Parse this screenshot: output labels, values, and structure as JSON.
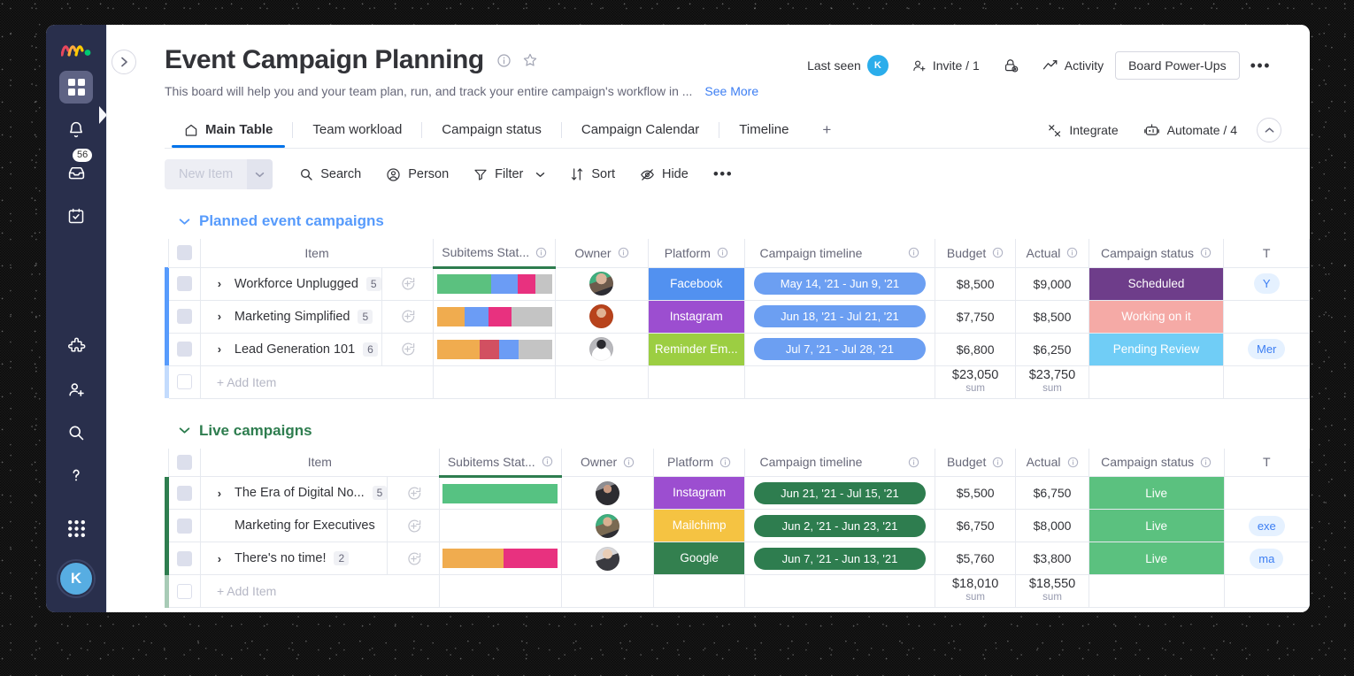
{
  "rail": {
    "logo": "monday-logo",
    "items": [
      {
        "name": "home-grid",
        "icon": "grid-icon",
        "active": true
      },
      {
        "name": "notifications",
        "icon": "bell-icon",
        "active": false
      },
      {
        "name": "inbox",
        "icon": "inbox-icon",
        "active": false,
        "badge": "56"
      },
      {
        "name": "my-work",
        "icon": "calendar-check-icon",
        "active": false
      },
      {
        "name": "apps",
        "icon": "puzzle-icon",
        "active": false
      },
      {
        "name": "invite",
        "icon": "person-add-icon",
        "active": false
      },
      {
        "name": "search",
        "icon": "search-icon",
        "active": false
      },
      {
        "name": "help",
        "icon": "question-icon",
        "active": false
      },
      {
        "name": "products",
        "icon": "dots-grid-icon",
        "active": false
      }
    ],
    "avatar_initial": "K"
  },
  "header": {
    "title": "Event Campaign Planning",
    "description": "This board will help you and your team plan, run, and track your entire campaign's workflow in ...",
    "see_more": "See More",
    "last_seen_label": "Last seen",
    "last_seen_initial": "K",
    "invite_label": "Invite / 1",
    "activity_label": "Activity",
    "power_ups_label": "Board Power-Ups",
    "more_label": "•••"
  },
  "tabs": [
    {
      "label": "Main Table",
      "icon": "home-icon",
      "active": true
    },
    {
      "label": "Team workload",
      "icon": "",
      "active": false
    },
    {
      "label": "Campaign status",
      "icon": "",
      "active": false
    },
    {
      "label": "Campaign Calendar",
      "icon": "",
      "active": false
    },
    {
      "label": "Timeline",
      "icon": "",
      "active": false
    }
  ],
  "tabs_add_label": "+",
  "tabbar_right": {
    "integrate_label": "Integrate",
    "automate_label": "Automate / 4"
  },
  "toolbar": {
    "new_item_label": "New Item",
    "search_label": "Search",
    "person_label": "Person",
    "filter_label": "Filter",
    "sort_label": "Sort",
    "hide_label": "Hide",
    "more_label": "•••"
  },
  "columns": [
    {
      "key": "item",
      "label": "Item",
      "info": false
    },
    {
      "key": "subst",
      "label": "Subitems Stat...",
      "info": true
    },
    {
      "key": "owner",
      "label": "Owner",
      "info": true
    },
    {
      "key": "plat",
      "label": "Platform",
      "info": true
    },
    {
      "key": "time",
      "label": "Campaign timeline",
      "info": true
    },
    {
      "key": "budget",
      "label": "Budget",
      "info": true
    },
    {
      "key": "actual",
      "label": "Actual",
      "info": true
    },
    {
      "key": "status",
      "label": "Campaign status",
      "info": true
    },
    {
      "key": "tags",
      "label": "T",
      "info": false
    }
  ],
  "add_item_label": "+ Add Item",
  "sum_label": "sum",
  "colors": {
    "group_planned": "#579bfc",
    "group_live": "#2e7d4f",
    "accent_blue": "#0073ea",
    "rail_bg": "#292f4c",
    "done_green": "#00c875",
    "stuck_red": "#e2445c",
    "working_orange": "#fdab3d",
    "pink": "#e8246f",
    "grey": "#c4c4c4",
    "blue_bar": "#579bfc"
  },
  "groups": [
    {
      "name": "Planned event campaigns",
      "color": "#579bfc",
      "title_color": "#579bfc",
      "rows": [
        {
          "item": "Workforce Unplugged",
          "subitems": "5",
          "expandable": true,
          "subbar": [
            {
              "color": "#5bc17f",
              "pct": 47
            },
            {
              "color": "#6b9cf5",
              "pct": 23
            },
            {
              "color": "#e8317f",
              "pct": 16
            },
            {
              "color": "#c4c4c4",
              "pct": 14
            }
          ],
          "avatar": "#9aa27e",
          "platform": {
            "label": "Facebook",
            "color": "#5291f0"
          },
          "timeline": {
            "label": "May 14, '21 - Jun 9, '21",
            "color": "#6c9ff2"
          },
          "budget": "$8,500",
          "actual": "$9,000",
          "status": {
            "label": "Scheduled",
            "color": "#6e3d8a"
          },
          "tag": "Y"
        },
        {
          "item": "Marketing Simplified",
          "subitems": "5",
          "expandable": true,
          "subbar": [
            {
              "color": "#f0ac4f",
              "pct": 24
            },
            {
              "color": "#6b9cf5",
              "pct": 21
            },
            {
              "color": "#e8317f",
              "pct": 20
            },
            {
              "color": "#c4c4c4",
              "pct": 35
            }
          ],
          "avatar": "#b4441e",
          "platform": {
            "label": "Instagram",
            "color": "#9c4ed0"
          },
          "timeline": {
            "label": "Jun 18, '21 - Jul 21, '21",
            "color": "#6c9ff2"
          },
          "budget": "$7,750",
          "actual": "$8,500",
          "status": {
            "label": "Working on it",
            "color": "#f5aaa6"
          },
          "tag": ""
        },
        {
          "item": "Lead Generation 101",
          "subitems": "6",
          "expandable": true,
          "subbar": [
            {
              "color": "#f0ac4f",
              "pct": 37
            },
            {
              "color": "#d25061",
              "pct": 17
            },
            {
              "color": "#6b9cf5",
              "pct": 17
            },
            {
              "color": "#c4c4c4",
              "pct": 29
            }
          ],
          "avatar": "#aaaaaa",
          "platform": {
            "label": "Reminder Em...",
            "color": "#9cce42"
          },
          "timeline": {
            "label": "Jul 7, '21 - Jul 28, '21",
            "color": "#6c9ff2"
          },
          "budget": "$6,800",
          "actual": "$6,250",
          "status": {
            "label": "Pending Review",
            "color": "#70cdf6"
          },
          "tag": "Mer"
        }
      ],
      "budget_sum": "$23,050",
      "actual_sum": "$23,750"
    },
    {
      "name": "Live campaigns",
      "color": "#2e7d4f",
      "title_color": "#2e7d4f",
      "rows": [
        {
          "item": "The Era of Digital No...",
          "subitems": "5",
          "expandable": true,
          "subbar": [
            {
              "color": "#56c282",
              "pct": 100
            }
          ],
          "avatar": "#6f6f74",
          "platform": {
            "label": "Instagram",
            "color": "#9c4ed0"
          },
          "timeline": {
            "label": "Jun 21, '21 - Jul 15, '21",
            "color": "#2e7d4f"
          },
          "budget": "$5,500",
          "actual": "$6,750",
          "status": {
            "label": "Live",
            "color": "#5bc17f"
          },
          "tag": ""
        },
        {
          "item": "Marketing for Executives",
          "subitems": "",
          "expandable": false,
          "subbar": [],
          "avatar": "#8d9376",
          "platform": {
            "label": "Mailchimp",
            "color": "#f5c342"
          },
          "timeline": {
            "label": "Jun 2, '21 - Jun 23, '21",
            "color": "#2e7d4f"
          },
          "budget": "$6,750",
          "actual": "$8,000",
          "status": {
            "label": "Live",
            "color": "#5bc17f"
          },
          "tag": "exe"
        },
        {
          "item": "There's no time!",
          "subitems": "2",
          "expandable": true,
          "subbar": [
            {
              "color": "#f0ac4f",
              "pct": 53
            },
            {
              "color": "#e8317f",
              "pct": 47
            }
          ],
          "avatar": "#9b9b9b",
          "platform": {
            "label": "Google",
            "color": "#33804f"
          },
          "timeline": {
            "label": "Jun 7, '21 - Jun 13, '21",
            "color": "#2e7d4f"
          },
          "budget": "$5,760",
          "actual": "$3,800",
          "status": {
            "label": "Live",
            "color": "#5bc17f"
          },
          "tag": "ma"
        }
      ],
      "budget_sum": "$18,010",
      "actual_sum": "$18,550"
    }
  ]
}
